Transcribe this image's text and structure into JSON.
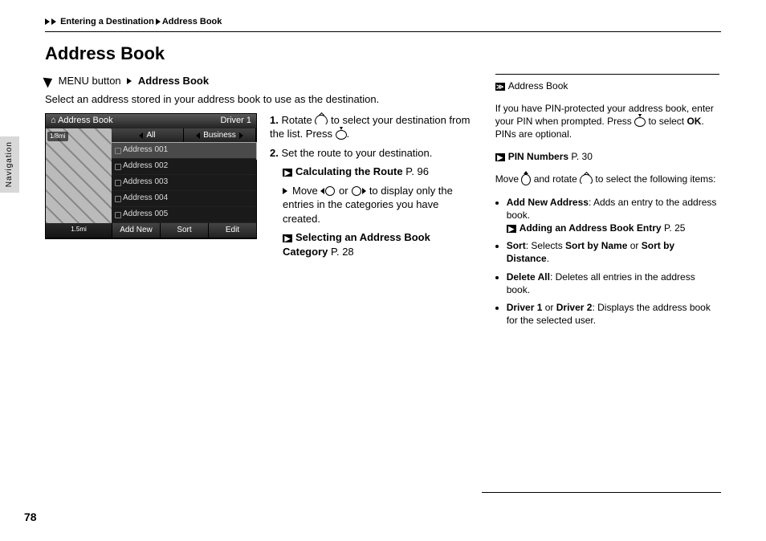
{
  "breadcrumb": {
    "part1": "Entering a Destination",
    "part2": "Address Book"
  },
  "title": "Address Book",
  "sideTab": "Navigation",
  "menuLine": {
    "pre": "MENU button",
    "post": "Address Book"
  },
  "intro": "Select an address stored in your address book to use as the destination.",
  "shot": {
    "title": "Address Book",
    "driver": "Driver 1",
    "tabAll": "All",
    "tabBiz": "Business",
    "rows": [
      "Address 001",
      "Address 002",
      "Address 003",
      "Address 004",
      "Address 005"
    ],
    "scaleTop": "1/8mi",
    "scaleBottom": "1.5mi",
    "btnAdd": "Add New",
    "btnSort": "Sort",
    "btnEdit": "Edit"
  },
  "steps": {
    "s1a": "Rotate ",
    "s1b": " to select your destination from the list. Press ",
    "s1c": ".",
    "s2a": "Set the route to your destination.",
    "x1": "Calculating the Route",
    "x1p": "P. 96",
    "sub1a": "Move ",
    "sub1b": " or ",
    "sub1c": " to display only the entries in the categories you have created.",
    "x2": "Selecting an Address Book Category",
    "x2p": "P. 28"
  },
  "side": {
    "head": "Address Book",
    "p1a": "If you have PIN-protected your address book, enter your PIN when prompted. Press ",
    "p1b": " to select ",
    "p1ok": "OK",
    "p1c": ". PINs are optional.",
    "x1": "PIN Numbers",
    "x1p": "P. 30",
    "p2a": "Move ",
    "p2b": " and rotate ",
    "p2c": " to select the following items:",
    "li1a": "Add New Address",
    "li1b": ": Adds an entry to the address book.",
    "x2": "Adding an Address Book Entry",
    "x2p": "P. 25",
    "li2a": "Sort",
    "li2b": ": Selects ",
    "li2c": "Sort by Name",
    "li2d": " or ",
    "li2e": "Sort by Distance",
    "li2f": ".",
    "li3a": "Delete All",
    "li3b": ": Deletes all entries in the address book.",
    "li4a": "Driver 1",
    "li4b": " or ",
    "li4c": "Driver 2",
    "li4d": ": Displays the address book for the selected user."
  },
  "pageNum": "78"
}
